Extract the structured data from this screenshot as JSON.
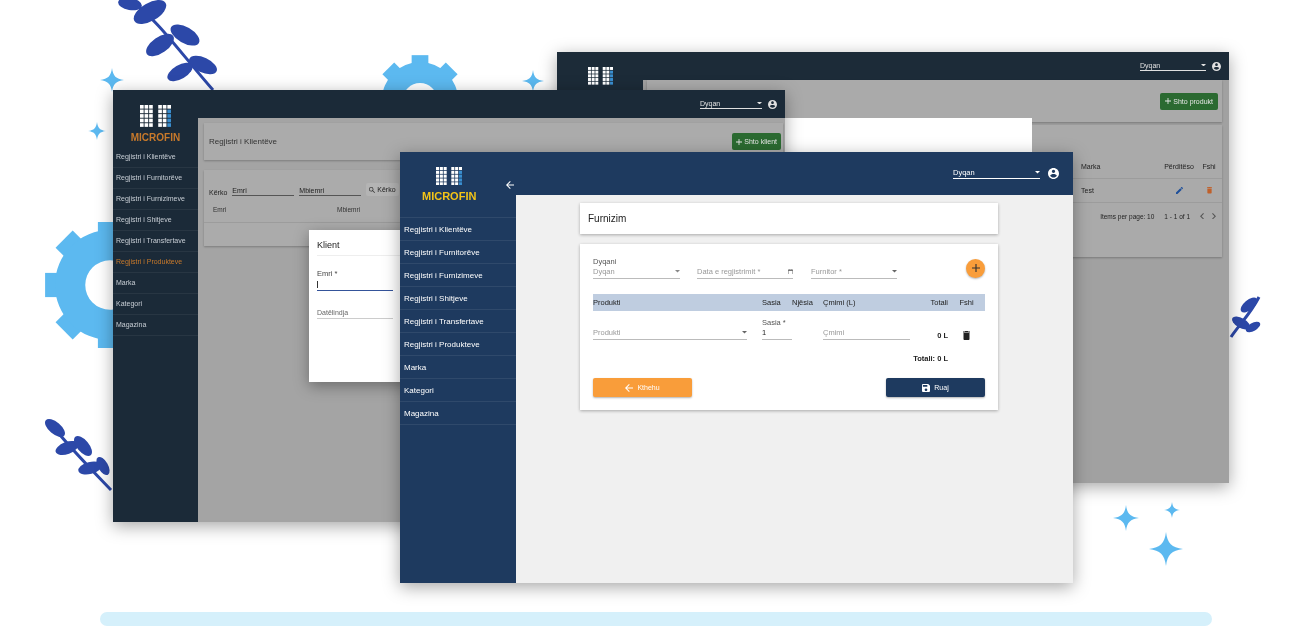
{
  "products_window": {
    "store_select": "Dyqan",
    "add_button": "Shto produkt",
    "table": {
      "columns": [
        "Marka",
        "Përditëso",
        "Fshi"
      ],
      "rows": [
        {
          "marka": "Test"
        }
      ]
    },
    "paginator": {
      "items_per_page": "Items per page: 10",
      "range": "1 - 1 of 1"
    }
  },
  "clients_window": {
    "logo": "MICROFIN",
    "menu": [
      {
        "label": "Regjistri i Klientëve",
        "selected": false
      },
      {
        "label": "Regjistri i Furnitorëve",
        "selected": false
      },
      {
        "label": "Regjistri i Furnizimeve",
        "selected": false
      },
      {
        "label": "Regjistri i Shitjeve",
        "selected": false
      },
      {
        "label": "Regjistri i Transfertave",
        "selected": false
      },
      {
        "label": "Regjistri i Produkteve",
        "selected": true
      },
      {
        "label": "Marka",
        "selected": false
      },
      {
        "label": "Kategori",
        "selected": false
      },
      {
        "label": "Magazina",
        "selected": false
      }
    ],
    "store_select": "Dyqan",
    "page_title": "Regjistri i Klientëve",
    "add_button": "Shto klient",
    "search": {
      "label": "Kërko",
      "fields": [
        {
          "placeholder": "Emri"
        },
        {
          "placeholder": "Mbiemri"
        }
      ],
      "button": "Kërko"
    },
    "table_columns": [
      "Emri",
      "Mbiemri"
    ],
    "dialog": {
      "title": "Klient",
      "name_field": {
        "label": "Emri *",
        "focused": true
      },
      "birth_field": {
        "placeholder": "Datëlindja"
      }
    }
  },
  "supply_window": {
    "logo": "MICROFIN",
    "menu": [
      {
        "label": "Regjistri i Klientëve",
        "selected": false
      },
      {
        "label": "Regjistri i Furnitorëve",
        "selected": false
      },
      {
        "label": "Regjistri i Furnizimeve",
        "selected": false
      },
      {
        "label": "Regjistri i Shitjeve",
        "selected": false
      },
      {
        "label": "Regjistri i Transfertave",
        "selected": false
      },
      {
        "label": "Regjistri i Produkteve",
        "selected": false
      },
      {
        "label": "Marka",
        "selected": false
      },
      {
        "label": "Kategori",
        "selected": false
      },
      {
        "label": "Magazina",
        "selected": false
      }
    ],
    "store_select": "Dyqan",
    "page_title": "Furnizim",
    "form": {
      "store": {
        "label": "Dyqani",
        "placeholder": "Dyqan"
      },
      "date": {
        "placeholder": "Data e regjistrimit *"
      },
      "supplier": {
        "placeholder": "Furnitor *"
      }
    },
    "table": {
      "columns": [
        "Produkti",
        "Sasia",
        "Njësia",
        "Çmimi (L)",
        "Totali",
        "Fshi"
      ],
      "rows": [
        {
          "product": "Produkti",
          "quantity_label": "Sasia *",
          "quantity": "1",
          "price": "Çmimi",
          "total": "0 L"
        }
      ]
    },
    "grand_total": "Totali: 0 L",
    "back_button": "Kthehu",
    "save_button": "Ruaj"
  }
}
